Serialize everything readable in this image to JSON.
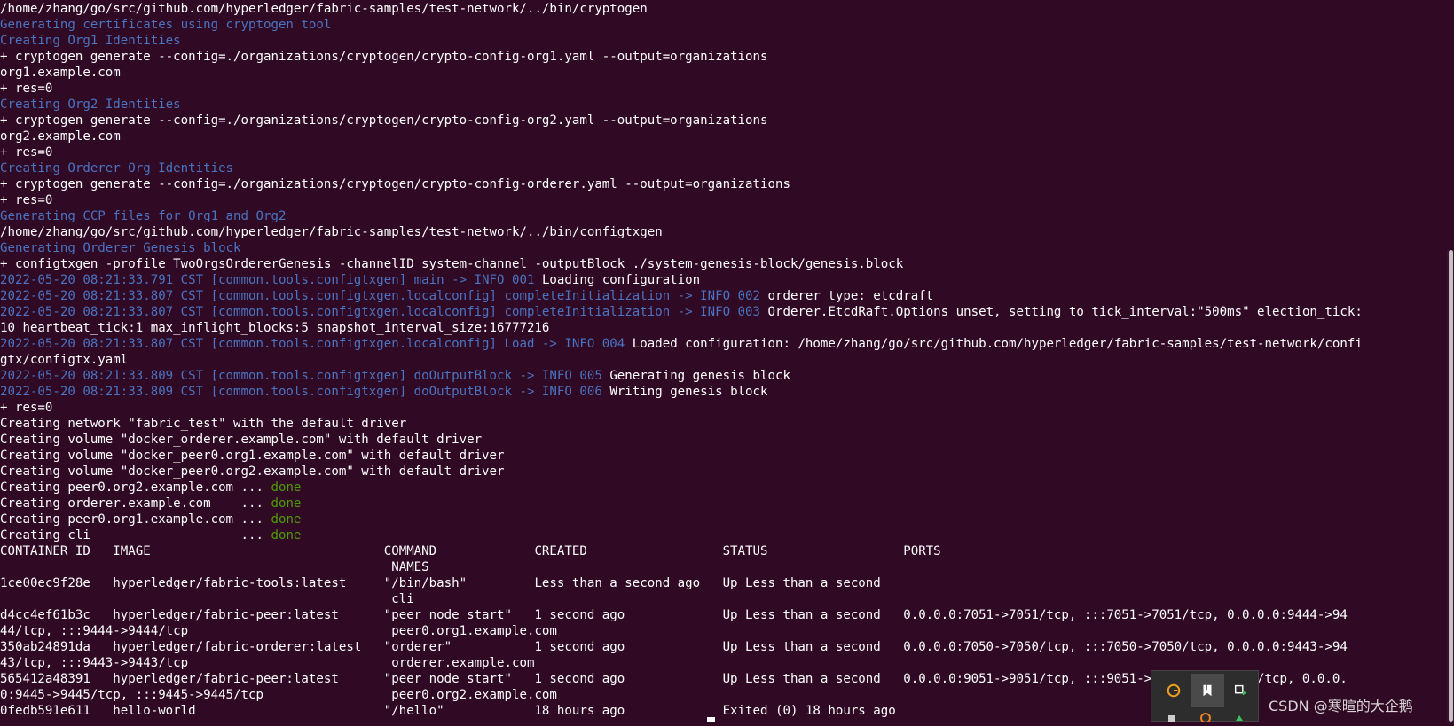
{
  "terminal": {
    "lines": [
      [
        {
          "t": "/home/zhang/go/src/github.com/hyperledger/fabric-samples/test-network/../bin/cryptogen",
          "c": "white"
        }
      ],
      [
        {
          "t": "Generating certificates using cryptogen tool",
          "c": "blue"
        }
      ],
      [
        {
          "t": "Creating Org1 Identities",
          "c": "blue"
        }
      ],
      [
        {
          "t": "+ cryptogen generate --config=./organizations/cryptogen/crypto-config-org1.yaml --output=organizations",
          "c": "white"
        }
      ],
      [
        {
          "t": "org1.example.com",
          "c": "white"
        }
      ],
      [
        {
          "t": "+ res=0",
          "c": "white"
        }
      ],
      [
        {
          "t": "Creating Org2 Identities",
          "c": "blue"
        }
      ],
      [
        {
          "t": "+ cryptogen generate --config=./organizations/cryptogen/crypto-config-org2.yaml --output=organizations",
          "c": "white"
        }
      ],
      [
        {
          "t": "org2.example.com",
          "c": "white"
        }
      ],
      [
        {
          "t": "+ res=0",
          "c": "white"
        }
      ],
      [
        {
          "t": "Creating Orderer Org Identities",
          "c": "blue"
        }
      ],
      [
        {
          "t": "+ cryptogen generate --config=./organizations/cryptogen/crypto-config-orderer.yaml --output=organizations",
          "c": "white"
        }
      ],
      [
        {
          "t": "+ res=0",
          "c": "white"
        }
      ],
      [
        {
          "t": "Generating CCP files for Org1 and Org2",
          "c": "blue"
        }
      ],
      [
        {
          "t": "/home/zhang/go/src/github.com/hyperledger/fabric-samples/test-network/../bin/configtxgen",
          "c": "white"
        }
      ],
      [
        {
          "t": "Generating Orderer Genesis block",
          "c": "blue"
        }
      ],
      [
        {
          "t": "+ configtxgen -profile TwoOrgsOrdererGenesis -channelID system-channel -outputBlock ./system-genesis-block/genesis.block",
          "c": "white"
        }
      ],
      [
        {
          "t": "2022-05-20 08:21:33.791 CST [common.tools.configtxgen] main -> INFO 001 ",
          "c": "blue"
        },
        {
          "t": "Loading configuration",
          "c": "white"
        }
      ],
      [
        {
          "t": "2022-05-20 08:21:33.807 CST [common.tools.configtxgen.localconfig] completeInitialization -> INFO 002 ",
          "c": "blue"
        },
        {
          "t": "orderer type: etcdraft",
          "c": "white"
        }
      ],
      [
        {
          "t": "2022-05-20 08:21:33.807 CST [common.tools.configtxgen.localconfig] completeInitialization -> INFO 003 ",
          "c": "blue"
        },
        {
          "t": "Orderer.EtcdRaft.Options unset, setting to tick_interval:\"500ms\" election_tick:",
          "c": "white"
        }
      ],
      [
        {
          "t": "10 heartbeat_tick:1 max_inflight_blocks:5 snapshot_interval_size:16777216",
          "c": "white"
        }
      ],
      [
        {
          "t": "2022-05-20 08:21:33.807 CST [common.tools.configtxgen.localconfig] Load -> INFO 004 ",
          "c": "blue"
        },
        {
          "t": "Loaded configuration: /home/zhang/go/src/github.com/hyperledger/fabric-samples/test-network/confi",
          "c": "white"
        }
      ],
      [
        {
          "t": "gtx/configtx.yaml",
          "c": "white"
        }
      ],
      [
        {
          "t": "2022-05-20 08:21:33.809 CST [common.tools.configtxgen] doOutputBlock -> INFO 005 ",
          "c": "blue"
        },
        {
          "t": "Generating genesis block",
          "c": "white"
        }
      ],
      [
        {
          "t": "2022-05-20 08:21:33.809 CST [common.tools.configtxgen] doOutputBlock -> INFO 006 ",
          "c": "blue"
        },
        {
          "t": "Writing genesis block",
          "c": "white"
        }
      ],
      [
        {
          "t": "+ res=0",
          "c": "white"
        }
      ],
      [
        {
          "t": "Creating network \"fabric_test\" with the default driver",
          "c": "white"
        }
      ],
      [
        {
          "t": "Creating volume \"docker_orderer.example.com\" with default driver",
          "c": "white"
        }
      ],
      [
        {
          "t": "Creating volume \"docker_peer0.org1.example.com\" with default driver",
          "c": "white"
        }
      ],
      [
        {
          "t": "Creating volume \"docker_peer0.org2.example.com\" with default driver",
          "c": "white"
        }
      ],
      [
        {
          "t": "Creating peer0.org2.example.com ... ",
          "c": "white"
        },
        {
          "t": "done",
          "c": "green"
        }
      ],
      [
        {
          "t": "Creating orderer.example.com    ... ",
          "c": "white"
        },
        {
          "t": "done",
          "c": "green"
        }
      ],
      [
        {
          "t": "Creating peer0.org1.example.com ... ",
          "c": "white"
        },
        {
          "t": "done",
          "c": "green"
        }
      ],
      [
        {
          "t": "Creating cli                    ... ",
          "c": "white"
        },
        {
          "t": "done",
          "c": "green"
        }
      ],
      [
        {
          "t": "CONTAINER ID   IMAGE                               COMMAND             CREATED                  STATUS                  PORTS",
          "c": "white"
        }
      ],
      [
        {
          "t": "                                                    NAMES",
          "c": "white"
        }
      ],
      [
        {
          "t": "1ce00ec9f28e   hyperledger/fabric-tools:latest     \"/bin/bash\"         Less than a second ago   Up Less than a second",
          "c": "white"
        }
      ],
      [
        {
          "t": "                                                    cli",
          "c": "white"
        }
      ],
      [
        {
          "t": "d4cc4ef61b3c   hyperledger/fabric-peer:latest      \"peer node start\"   1 second ago             Up Less than a second   0.0.0.0:7051->7051/tcp, :::7051->7051/tcp, 0.0.0.0:9444->94",
          "c": "white"
        }
      ],
      [
        {
          "t": "44/tcp, :::9444->9444/tcp                           peer0.org1.example.com",
          "c": "white"
        }
      ],
      [
        {
          "t": "350ab24891da   hyperledger/fabric-orderer:latest   \"orderer\"           1 second ago             Up Less than a second   0.0.0.0:7050->7050/tcp, :::7050->7050/tcp, 0.0.0.0:9443->94",
          "c": "white"
        }
      ],
      [
        {
          "t": "43/tcp, :::9443->9443/tcp                           orderer.example.com",
          "c": "white"
        }
      ],
      [
        {
          "t": "565412a48391   hyperledger/fabric-peer:latest      \"peer node start\"   1 second ago             Up Less than a second   0.0.0.0:9051->9051/tcp, :::9051->9051/tcp, 7051/tcp, 0.0.0.",
          "c": "white"
        }
      ],
      [
        {
          "t": "0:9445->9445/tcp, :::9445->9445/tcp                 peer0.org2.example.com",
          "c": "white"
        }
      ],
      [
        {
          "t": "0fedb591e611   hello-world                         \"/hello\"            18 hours ago             Exited (0) 18 hours ago",
          "c": "white"
        }
      ]
    ]
  },
  "colors": {
    "white": "#ffffff",
    "blue": "#4a73c2",
    "green": "#4e9a06",
    "background": "#300a24"
  },
  "tray": {
    "icons": [
      "grammarly-icon",
      "bookmark-icon",
      "screen-share-icon"
    ]
  },
  "watermark": {
    "text": "CSDN @寒暄的大企鹅"
  }
}
